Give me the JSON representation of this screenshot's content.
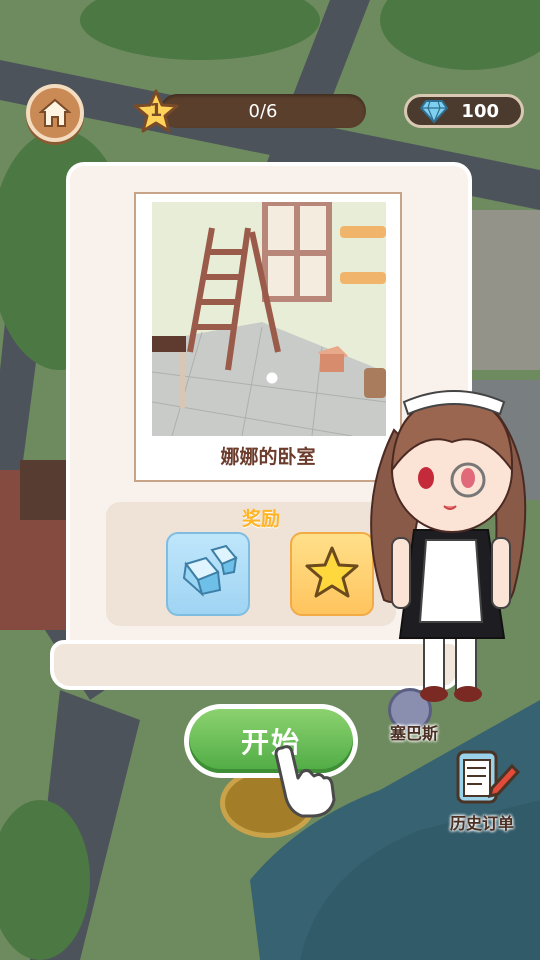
{
  "hud": {
    "level": "1",
    "progress_text": "0/6",
    "progress_value": 0,
    "progress_max": 6,
    "gems": "100"
  },
  "panel": {
    "room_name": "娜娜的卧室",
    "reward_title": "奖励",
    "rewards": [
      {
        "icon": "diamond-icon"
      },
      {
        "icon": "star-icon"
      }
    ]
  },
  "start_button": {
    "label": "开始"
  },
  "side": {
    "character_name": "塞巴斯",
    "history_orders": "历史订单"
  },
  "colors": {
    "accent_green": "#5cb94c",
    "panel_bg": "#f9f2ec",
    "title_brown": "#6b3b2c",
    "reward_orange": "#ffb526"
  }
}
